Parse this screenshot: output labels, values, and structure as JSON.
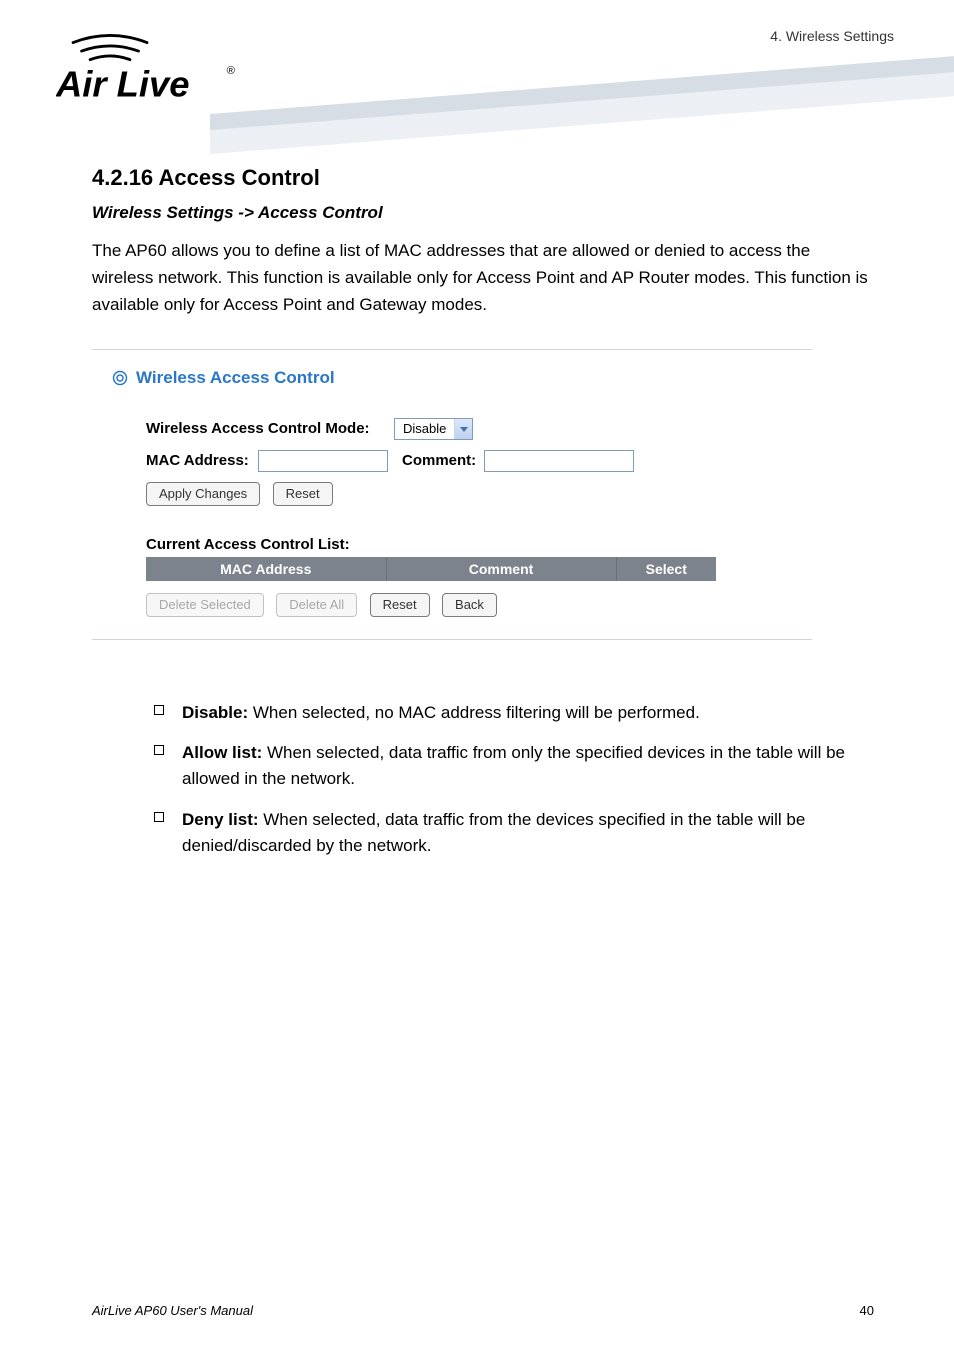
{
  "header": {
    "breadcrumb": "4. Wireless Settings",
    "logo_text_main": "ir Live",
    "logo_text_reg": "®"
  },
  "section": {
    "number_title": "4.2.16 Access Control",
    "subhead": "Wireless Settings -> Access Control",
    "para1": "The AP60 allows you to define a list of MAC addresses that are allowed or denied to access the wireless network.    This function is available only for Access Point and AP Router modes. This function is available only for Access Point and Gateway modes."
  },
  "panel": {
    "title": "Wireless Access Control",
    "mode_label": "Wireless Access Control Mode:",
    "mode_value": "Disable",
    "mac_label": "MAC Address:",
    "comment_label": "Comment:",
    "apply_btn": "Apply Changes",
    "reset_btn": "Reset",
    "list_title": "Current Access Control List:",
    "columns": {
      "mac": "MAC Address",
      "comment": "Comment",
      "select": "Select"
    },
    "delete_selected_btn": "Delete Selected",
    "delete_all_btn": "Delete All",
    "reset2_btn": "Reset",
    "back_btn": "Back"
  },
  "bullets": {
    "b1_bold": "Disable:",
    "b1_rest": " When selected, no MAC address filtering will be performed.",
    "b2_bold": "Allow list:",
    "b2_rest": " When selected, data traffic from only the specified devices in the table will be allowed in the network.",
    "b3_bold": "Deny list:",
    "b3_rest": " When selected, data traffic from the devices specified in the table will be denied/discarded by the network."
  },
  "footer": {
    "left": "AirLive AP60 User's Manual",
    "right": "40"
  }
}
